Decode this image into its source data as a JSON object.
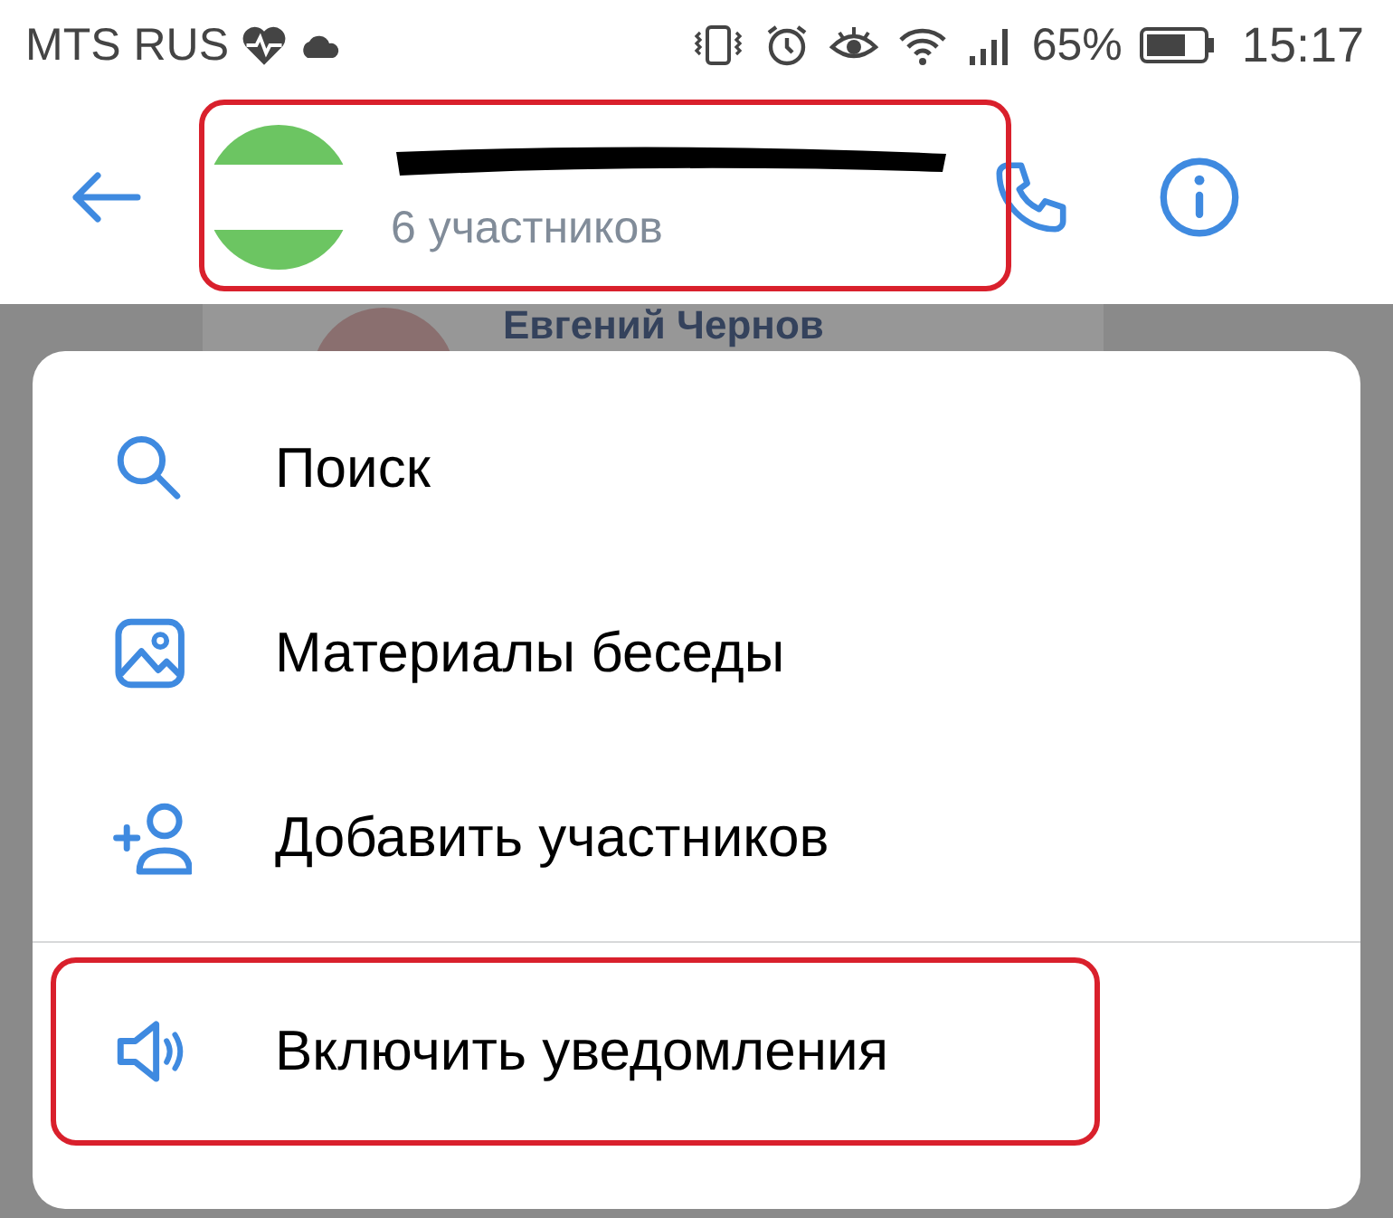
{
  "status_bar": {
    "carrier": "MTS RUS",
    "battery_percent": "65%",
    "time": "15:17"
  },
  "header": {
    "subtitle": "6 участников",
    "name_redacted": true
  },
  "background_chat": {
    "sender": "Евгений Чернов"
  },
  "menu": {
    "items": [
      {
        "kind": "search",
        "label": "Поиск",
        "highlighted": false
      },
      {
        "kind": "media",
        "label": "Материалы беседы",
        "highlighted": false
      },
      {
        "kind": "add-people",
        "label": "Добавить участников",
        "highlighted": false
      },
      {
        "kind": "sound",
        "label": "Включить уведомления",
        "highlighted": true,
        "divider_before": true
      }
    ]
  }
}
